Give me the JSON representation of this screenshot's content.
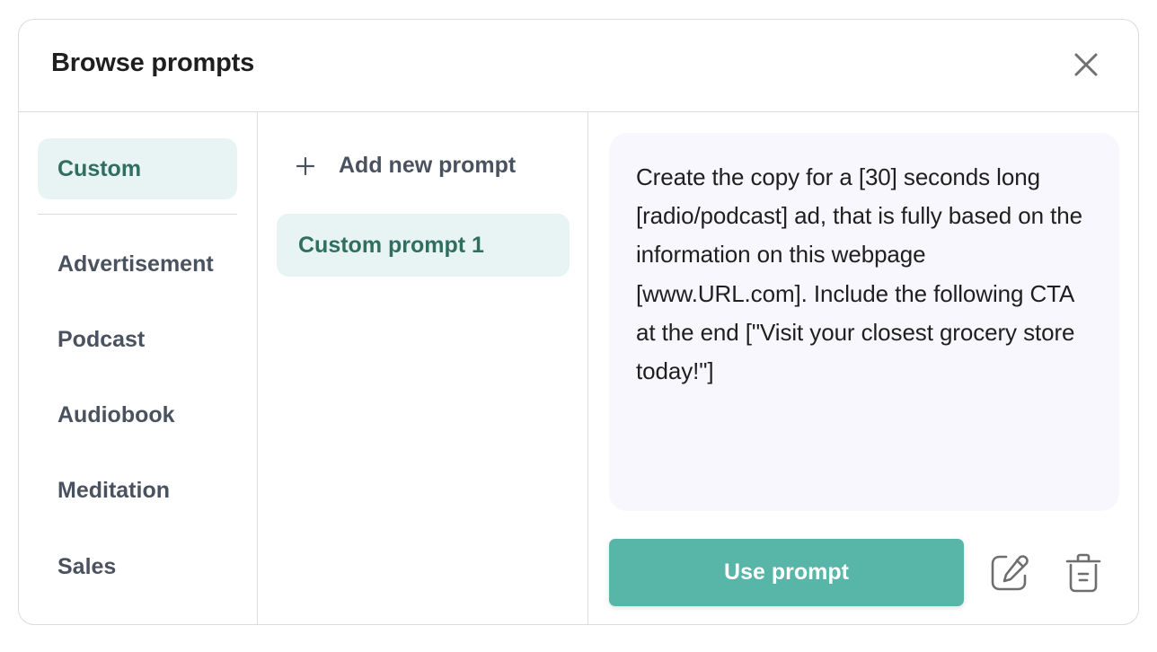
{
  "modal": {
    "title": "Browse prompts",
    "close_icon": "close-icon"
  },
  "categories": {
    "active": "Custom",
    "items": [
      {
        "label": "Custom",
        "active": true
      },
      {
        "label": "Advertisement",
        "active": false
      },
      {
        "label": "Podcast",
        "active": false
      },
      {
        "label": "Audiobook",
        "active": false
      },
      {
        "label": "Meditation",
        "active": false
      },
      {
        "label": "Sales",
        "active": false
      }
    ]
  },
  "prompts": {
    "add_label": "Add new prompt",
    "add_icon": "plus-icon",
    "items": [
      {
        "label": "Custom prompt 1",
        "selected": true
      }
    ]
  },
  "detail": {
    "prompt_text": "Create the copy for a [30] seconds long [radio/podcast] ad, that is fully based on the information on this webpage [www.URL.com]. Include the following CTA at the end [\"Visit your closest grocery store today!\"]",
    "use_button_label": "Use prompt",
    "edit_icon": "edit-icon",
    "delete_icon": "trash-icon"
  },
  "colors": {
    "accent": "#57b6a8",
    "active_bg": "#e8f4f3",
    "active_text": "#2f6e60",
    "text_muted": "#4a5260",
    "text_box_bg": "#f7f7fd",
    "border": "#dddddd"
  }
}
